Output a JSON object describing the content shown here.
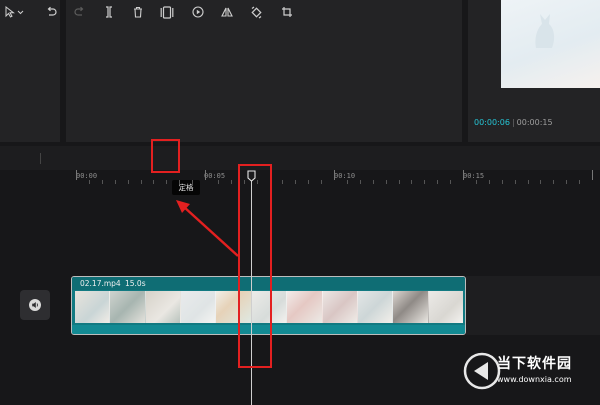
{
  "player": {
    "current_time": "00:00:06",
    "separator": "|",
    "total_time": "00:00:15"
  },
  "toolbar": {
    "items": [
      {
        "name": "select-tool",
        "icon": "cursor-arrow-icon"
      },
      {
        "name": "undo",
        "icon": "undo-icon"
      },
      {
        "name": "redo",
        "icon": "redo-icon"
      },
      {
        "name": "split",
        "icon": "split-icon"
      },
      {
        "name": "delete",
        "icon": "trash-icon"
      },
      {
        "name": "freeze-frame",
        "icon": "freeze-frame-icon"
      },
      {
        "name": "reverse",
        "icon": "play-circle-icon"
      },
      {
        "name": "mirror",
        "icon": "mirror-icon"
      },
      {
        "name": "rotate",
        "icon": "rotate-icon"
      },
      {
        "name": "crop",
        "icon": "crop-icon"
      }
    ],
    "tooltip": "定格"
  },
  "ruler": {
    "labels": [
      "00:00",
      "00:05",
      "00:10",
      "00:15"
    ]
  },
  "clip": {
    "name": "02.17.mp4",
    "duration": "15.0s"
  },
  "watermark": {
    "title": "当下软件园",
    "url": "www.downxia.com"
  },
  "colors": {
    "accent": "#25c4d4",
    "highlight": "#e32020",
    "clip": "#127a82"
  }
}
